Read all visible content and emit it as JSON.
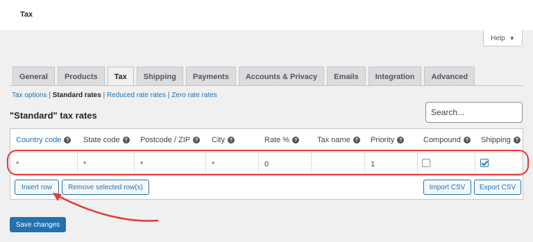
{
  "page": {
    "title": "Tax"
  },
  "help": {
    "label": "Help",
    "caret": "▼"
  },
  "tabs": [
    {
      "label": "General"
    },
    {
      "label": "Products"
    },
    {
      "label": "Tax"
    },
    {
      "label": "Shipping"
    },
    {
      "label": "Payments"
    },
    {
      "label": "Accounts & Privacy"
    },
    {
      "label": "Emails"
    },
    {
      "label": "Integration"
    },
    {
      "label": "Advanced"
    }
  ],
  "subnav": [
    {
      "label": "Tax options"
    },
    {
      "label": "Standard rates"
    },
    {
      "label": "Reduced rate rates"
    },
    {
      "label": "Zero rate rates"
    }
  ],
  "section": {
    "title": "\"Standard\" tax rates"
  },
  "search": {
    "placeholder": "Search..."
  },
  "table": {
    "columns": [
      "Country code",
      "State code",
      "Postcode / ZIP",
      "City",
      "Rate %",
      "Tax name",
      "Priority",
      "Compound",
      "Shipping"
    ],
    "row": {
      "country": "*",
      "state": "*",
      "postcode": "*",
      "city": "*",
      "rate": "0",
      "name": "",
      "priority": "1",
      "compound": false,
      "shipping": true
    }
  },
  "actions": {
    "insert_row": "Insert row",
    "remove_rows": "Remove selected row(s)",
    "import_csv": "Import CSV",
    "export_csv": "Export CSV"
  },
  "save": {
    "label": "Save changes"
  },
  "colors": {
    "accent": "#2271b1",
    "annotation": "#e53935"
  }
}
